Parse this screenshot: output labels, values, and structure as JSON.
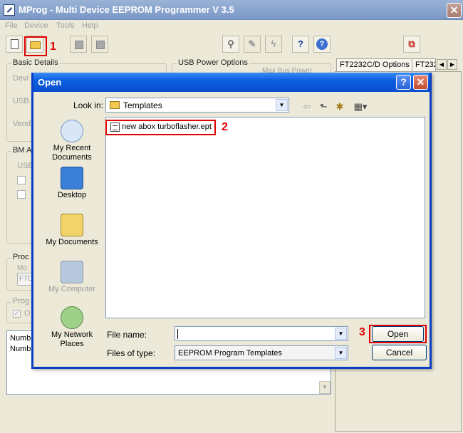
{
  "app": {
    "title": "MProg - Multi Device EEPROM Programmer V 3.5",
    "close_glyph": "✕"
  },
  "menu": [
    "File",
    "Device",
    "Tools",
    "Help"
  ],
  "toolbar": {
    "callout_1": "1",
    "help_glyph": "?",
    "info_glyph": "?"
  },
  "background": {
    "basic_details": "Basic Details",
    "usb_power_options": "USB Power Options",
    "max_bus_power_fragment": "Max Bus Power",
    "basic_fragments": [
      "Devi",
      "USB",
      "Vend"
    ],
    "bm_fragment": "BM A",
    "usb_fragment": "USB",
    "proc_fragment": "Proc",
    "mod_fragment": "Mo",
    "ftd_fragment": "FTD",
    "prog_fragment": "Prog",
    "opt_fragment": "O",
    "tabs": [
      "FT2232C/D Options",
      "FT232"
    ],
    "log_lines": [
      "Numb",
      "Numb"
    ]
  },
  "dialog": {
    "title": "Open",
    "help_glyph": "?",
    "close_glyph": "✕",
    "look_in_label": "Look in:",
    "look_in_value": "Templates",
    "places": [
      {
        "label_lines": [
          "My Recent",
          "Documents"
        ],
        "icon": "recent-documents-icon"
      },
      {
        "label_lines": [
          "Desktop"
        ],
        "icon": "desktop-icon"
      },
      {
        "label_lines": [
          "My Documents"
        ],
        "icon": "my-documents-icon"
      },
      {
        "label_lines": [
          "My Computer"
        ],
        "icon": "my-computer-icon"
      },
      {
        "label_lines": [
          "My Network",
          "Places"
        ],
        "icon": "network-places-icon"
      }
    ],
    "files": [
      {
        "name": "new abox turboflasher.ept"
      }
    ],
    "callout_2": "2",
    "callout_3": "3",
    "file_name_label": "File name:",
    "file_name_value": "",
    "files_of_type_label": "Files of type:",
    "files_of_type_value": "EEPROM Program Templates",
    "open_button": "Open",
    "cancel_button": "Cancel"
  },
  "colors": {
    "callout": "#e00000",
    "dialog_title": "#0a4fd0",
    "window_bg": "#ece9d8"
  }
}
